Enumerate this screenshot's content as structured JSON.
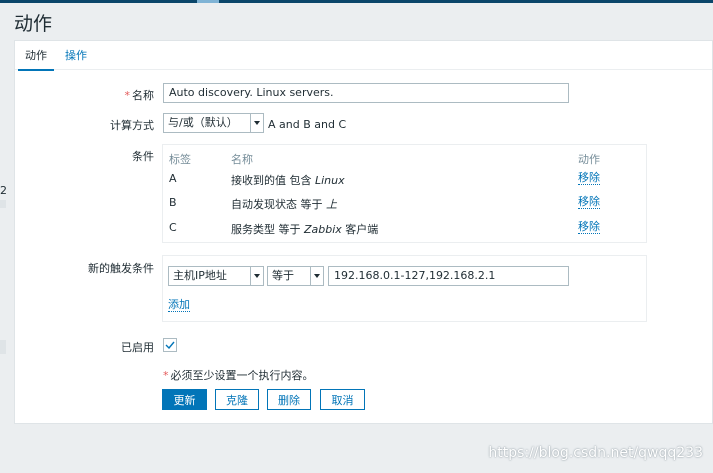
{
  "header": {
    "title": "动作"
  },
  "tabs": [
    {
      "label": "动作",
      "active": true
    },
    {
      "label": "操作",
      "active": false
    }
  ],
  "form": {
    "name_label": "名称",
    "name_value": "Auto discovery. Linux servers.",
    "calc_label": "计算方式",
    "calc_value": "与/或（默认）",
    "calc_expression": "A and B and C",
    "conditions_label": "条件",
    "conditions": {
      "headers": {
        "tag": "标签",
        "name": "名称",
        "action": "动作"
      },
      "rows": [
        {
          "tag": "A",
          "text": "接收到的值 包含 ",
          "italic": "Linux",
          "suffix": "",
          "action": "移除"
        },
        {
          "tag": "B",
          "text": "自动发现状态 等于 ",
          "italic": "上",
          "suffix": "",
          "action": "移除"
        },
        {
          "tag": "C",
          "text": "服务类型 等于 ",
          "italic": "Zabbix",
          "suffix": " 客户端",
          "action": "移除"
        }
      ]
    },
    "new_condition_label": "新的触发条件",
    "new_condition": {
      "type": "主机IP地址",
      "operator": "等于",
      "value": "192.168.0.1-127,192.168.2.1",
      "add_link": "添加"
    },
    "enabled_label": "已启用",
    "enabled": true,
    "required_note": "必须至少设置一个执行内容。"
  },
  "buttons": {
    "update": "更新",
    "clone": "克隆",
    "delete": "删除",
    "cancel": "取消"
  },
  "watermark": "https://blog.csdn.net/qwqq233",
  "colors": {
    "accent": "#0275b8",
    "required": "#e45959",
    "header_bar": "#0a466a"
  }
}
